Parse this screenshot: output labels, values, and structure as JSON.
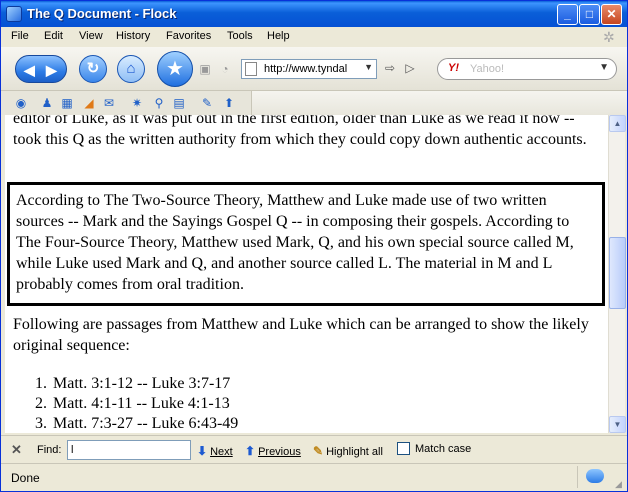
{
  "window": {
    "title": "The Q Document - Flock"
  },
  "menubar": {
    "items": [
      {
        "label": "File"
      },
      {
        "label": "Edit"
      },
      {
        "label": "View"
      },
      {
        "label": "History"
      },
      {
        "label": "Favorites"
      },
      {
        "label": "Tools"
      },
      {
        "label": "Help"
      }
    ]
  },
  "navbar": {
    "url": "http://www.tyndal",
    "search_placeholder": "Yahoo!",
    "search_engine_icon": "Y!"
  },
  "content": {
    "para_top": "editor of Luke, as it was put out in the first edition, older than Luke as we read it now -- took this Q as the written authority from which they could copy down authentic accounts.",
    "boxed": "According to The Two-Source Theory, Matthew and Luke made use of two written sources -- Mark and the Sayings Gospel Q -- in composing their gospels. According to The Four-Source Theory, Matthew used Mark, Q, and his own special source called M, while Luke used Mark and Q, and another source called L. The material in M and L probably comes from oral tradition.",
    "para_follow": "Following are passages from Matthew and Luke which can be arranged to show the likely original sequence:",
    "list": [
      {
        "num": "1.",
        "text": "Matt. 3:1-12 -- Luke 3:7-17"
      },
      {
        "num": "2.",
        "text": "Matt. 4:1-11 -- Luke 4:1-13"
      },
      {
        "num": "3.",
        "text": "Matt. 7:3-27 -- Luke 6:43-49"
      }
    ]
  },
  "findbar": {
    "label": "Find:",
    "value": "l",
    "next": "Next",
    "previous": "Previous",
    "highlight_all": "Highlight all",
    "match_case": "Match case"
  },
  "statusbar": {
    "text": "Done"
  }
}
